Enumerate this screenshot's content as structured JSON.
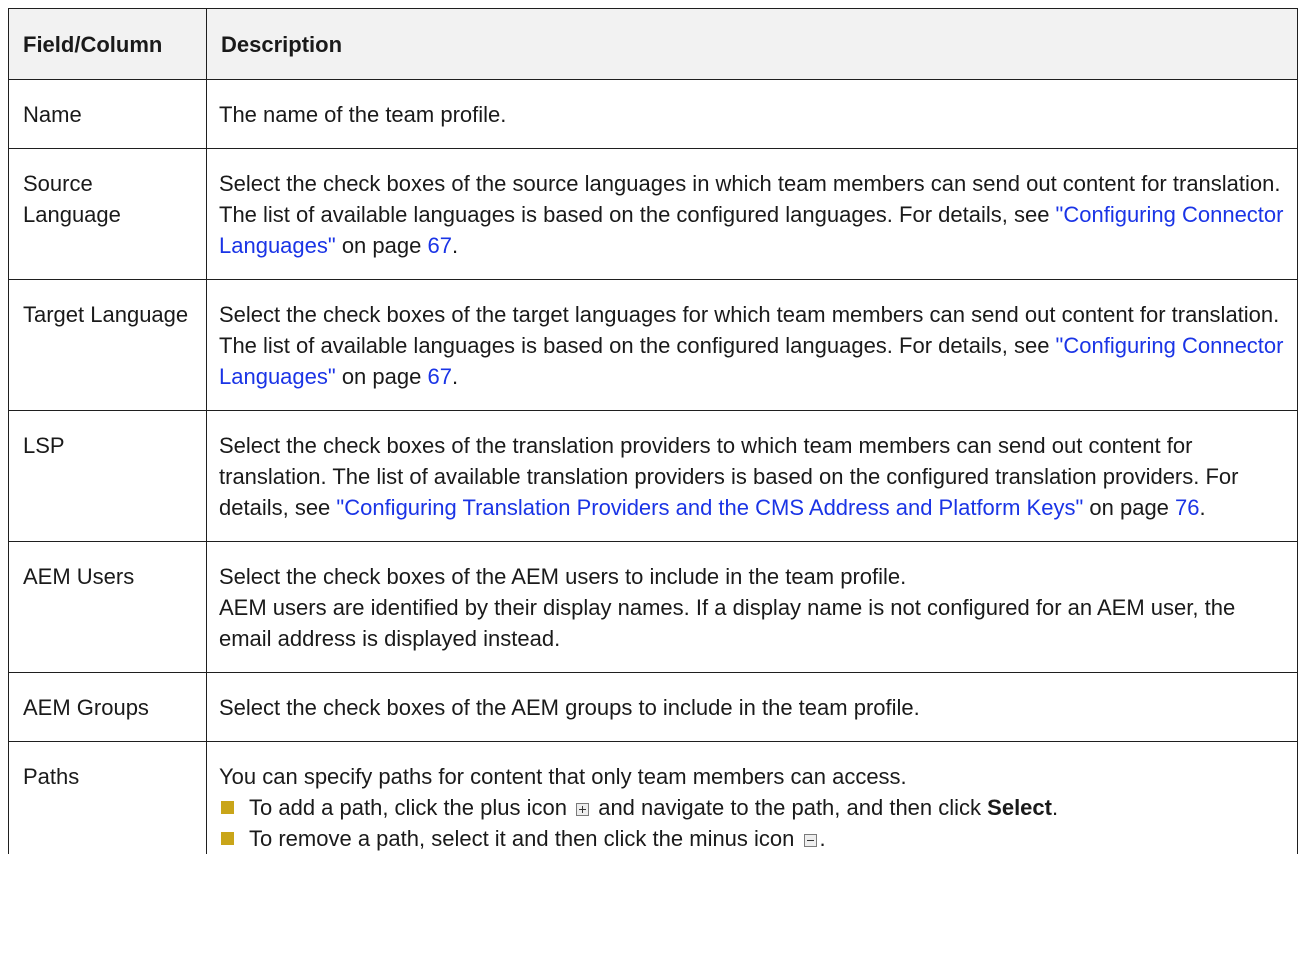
{
  "table": {
    "headers": [
      "Field/Column",
      "Description"
    ],
    "rows": [
      {
        "field": "Name",
        "desc": "The name of the team profile."
      },
      {
        "field": "Source Language",
        "desc_before": "Select the check boxes of the source languages in which team members can send out content for translation. The list of available languages is based on the configured languages. For details, see ",
        "link": "\"Configuring Connector Languages\"",
        "desc_mid": " on page ",
        "page": "67",
        "desc_end": "."
      },
      {
        "field": "Target Language",
        "desc_before": "Select the check boxes of the target languages for which team members can send out content for translation. The list of available languages is based on the configured languages. For details, see ",
        "link": "\"Configuring Connector Languages\"",
        "desc_mid": " on page ",
        "page": "67",
        "desc_end": "."
      },
      {
        "field": "LSP",
        "desc_before": "Select the check boxes of the translation providers to which team members can send out content for translation. The list of available translation providers is based on the configured translation providers. For details, see ",
        "link": "\"Configuring Translation Providers and the CMS Address and Platform Keys\"",
        "desc_mid": " on page ",
        "page": "76",
        "desc_end": "."
      },
      {
        "field": "AEM Users",
        "desc_line1": "Select the check boxes of the AEM users to include in the team profile.",
        "desc_line2": "AEM users are identified by their display names. If a display name is not configured for an AEM user, the email address is displayed instead."
      },
      {
        "field": "AEM Groups",
        "desc": "Select the check boxes of the AEM groups to include in the team profile."
      },
      {
        "field": "Paths",
        "intro": "You can specify paths for content that only team members can access.",
        "bullet1_before": "To add a path, click the plus icon ",
        "bullet1_mid": " and navigate to the path, and then click ",
        "bullet1_bold": "Select",
        "bullet1_end": ".",
        "bullet2_before": "To remove a path, select it and then click the minus icon ",
        "bullet2_end": "."
      }
    ]
  },
  "colors": {
    "link": "#1a34e6",
    "bullet": "#c9a519",
    "header_bg": "#f2f2f2"
  },
  "icons": [
    "plus-icon",
    "minus-icon",
    "bullet-square-icon"
  ]
}
